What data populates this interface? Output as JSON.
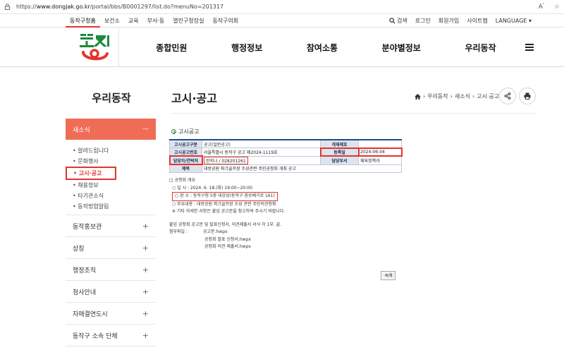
{
  "browser": {
    "url_prefix": "https://",
    "url_host": "www.dongjak.go.kr",
    "url_path": "/portal/bbs/B0001297/list.do?menuNo=201317"
  },
  "util_nav": [
    "동작구청홈",
    "보건소",
    "교육",
    "부서·동",
    "열린구청장실",
    "동작구의회"
  ],
  "util_right": {
    "search": "검색",
    "login": "로그인",
    "join": "회원가입",
    "sitemap": "사이트맵",
    "language": "LANGUAGE ▾"
  },
  "gnb": [
    "종합민원",
    "행정정보",
    "참여소통",
    "분야별정보",
    "우리동작"
  ],
  "sidebar": {
    "title": "우리동작",
    "active_group": "새소식",
    "sub_items": [
      "• 알려드립니다",
      "• 문화행사",
      "• 고시·공고",
      "• 채용정보",
      "• 타기관소식",
      "• 동작법업알림"
    ],
    "groups": [
      "동작홍보관",
      "상징",
      "행정조직",
      "청사안내",
      "자매결연도시",
      "동작구 소속 단체"
    ]
  },
  "page_title": "고시·공고",
  "breadcrumb": [
    "›",
    "우리동작",
    "›",
    "새소식",
    "›",
    "고시·공고"
  ],
  "section_label": "고시공고",
  "meta": {
    "r1": {
      "k1": "고시공고구분",
      "v1": "공고(일반공고)",
      "k2": "게재제호",
      "v2": ""
    },
    "r2": {
      "k1": "고시공고번호",
      "v1": "서울특별시 동작구 공고 제2024-1119호",
      "k2": "등록일",
      "v2": "2024-06-04"
    },
    "r3": {
      "k1": "담당자/연락처",
      "v1": "한지나 / 028201261",
      "k2": "담당부서",
      "v2": "체육정책과"
    },
    "r4": {
      "k1": "제목",
      "v1": "대방공원 파크골프장 조성관련 주민공청회 개최 공고"
    }
  },
  "body": {
    "l1": "□ 공청회 개요",
    "l2": "○ 일      시 : 2024. 6. 18.(화) 19:00~20:00",
    "l3": "○ 장      소 : 동작구청 5층 대강당(동작구 장승배기로 161)",
    "l4": "○ 주요내용 : 대방공원 파크골프장 조성 관련 주민의견청취",
    "l5": "※ 기타 자세한 사항은 붙임 공고문을 참고하여 주시기 바랍니다.",
    "l6": "붙임 공청회 공고문 및 발표신청서, 의견제출서 서식 각 1부.  끝.",
    "attach_label": "첨부파일 :",
    "files": [
      "공고문.hwpx",
      "공청회 발표 신청서.hwpx",
      "공청회 의견 제출서.hwpx"
    ]
  },
  "list_button": "목록",
  "colors": {
    "accent": "#ef6c56",
    "highlight": "#e3342f",
    "table_border": "#1d4e8f"
  }
}
